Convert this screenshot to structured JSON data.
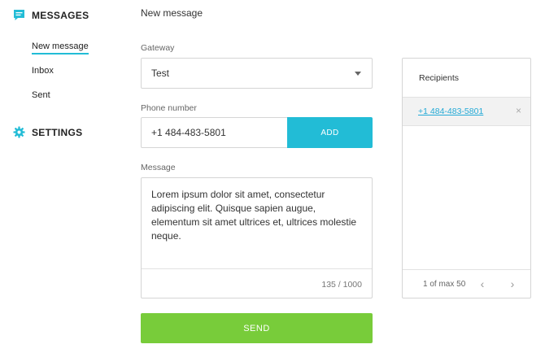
{
  "sidebar": {
    "messages": {
      "label": "MESSAGES",
      "icon": "chat-bubble-icon"
    },
    "items": [
      {
        "label": "New message",
        "active": true
      },
      {
        "label": "Inbox",
        "active": false
      },
      {
        "label": "Sent",
        "active": false
      }
    ],
    "settings": {
      "label": "SETTINGS",
      "icon": "gear-icon"
    }
  },
  "main": {
    "title": "New message",
    "gateway": {
      "label": "Gateway",
      "value": "Test"
    },
    "phone": {
      "label": "Phone number",
      "value": "+1 484-483-5801",
      "add_label": "ADD"
    },
    "message": {
      "label": "Message",
      "value": "Lorem ipsum dolor sit amet, consectetur adipiscing elit. Quisque sapien augue, elementum sit amet ultrices et, ultrices molestie neque.",
      "counter": "135 / 1000"
    },
    "send_label": "SEND"
  },
  "recipients": {
    "title": "Recipients",
    "items": [
      {
        "number": "+1 484-483-5801",
        "remove": "×"
      }
    ],
    "count_text": "1 of max 50",
    "prev": "‹",
    "next": "›"
  },
  "colors": {
    "accent": "#22bcd6",
    "send": "#78cc3a",
    "link": "#22a9d6"
  }
}
